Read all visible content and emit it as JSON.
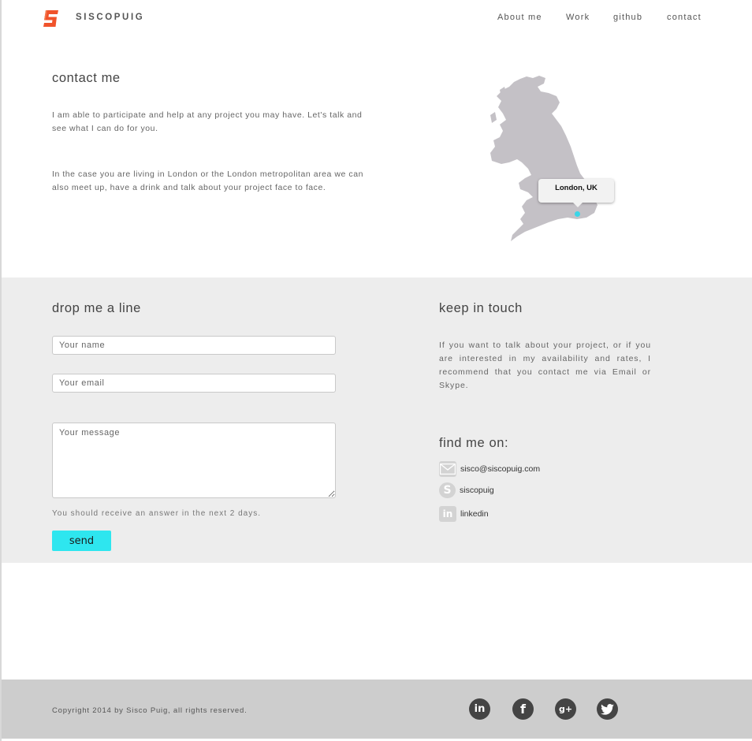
{
  "header": {
    "brand": "SISCOPUIG",
    "nav": [
      "About me",
      "Work",
      "github",
      "contact"
    ]
  },
  "contact": {
    "title": "contact me",
    "paragraph1": "I am able to participate and help at any project you may have. Let's talk and see what I can do for you.",
    "paragraph2": "In the case you are living in London or the London metropolitan area we can also meet up, have a drink and talk about your project face to face.",
    "map_label": "London, UK"
  },
  "form": {
    "title": "drop me a line",
    "name_placeholder": "Your name",
    "email_placeholder": "Your email",
    "message_placeholder": "Your message",
    "note": "You should receive an answer in the next 2 days.",
    "send_label": "send"
  },
  "touch": {
    "title": "keep in touch",
    "text": "If you want to talk about your project, or if you are interested in my availability and rates, I recommend that you contact me via Email or Skype.",
    "find_title": "find me on:",
    "links": [
      {
        "icon": "envelope-icon",
        "label": "sisco@siscopuig.com"
      },
      {
        "icon": "skype-icon",
        "label": "siscopuig"
      },
      {
        "icon": "linkedin-icon",
        "label": "linkedin"
      }
    ]
  },
  "footer": {
    "copyright": "Copyright 2014 by Sisco Puig, all rights reserved.",
    "social": [
      "linkedin-icon",
      "facebook-icon",
      "google-plus-icon",
      "twitter-icon"
    ]
  },
  "colors": {
    "accent": "#2ee6ef",
    "logo": "#f0532b",
    "section_gray": "#ededed",
    "footer_gray": "#cdcdcd"
  }
}
